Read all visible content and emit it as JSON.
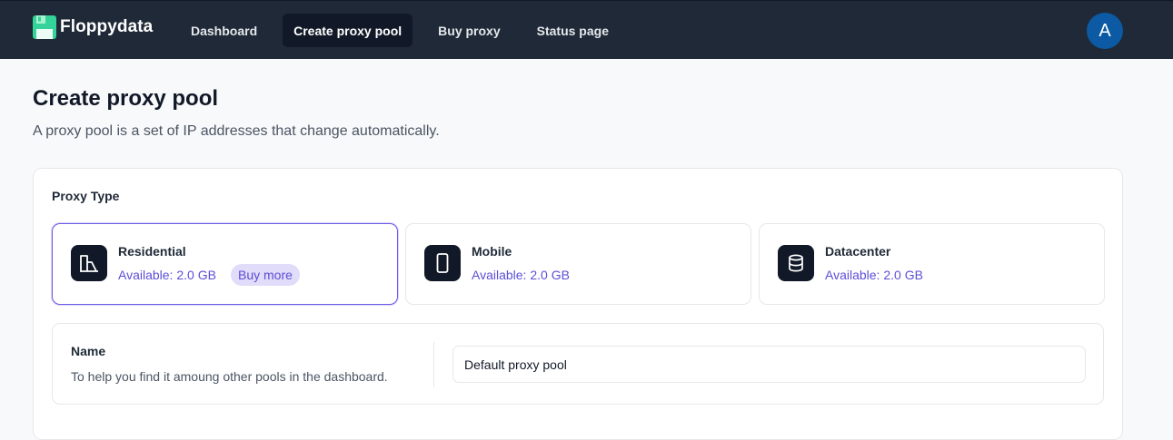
{
  "header": {
    "brand": "Floppydata",
    "nav": [
      {
        "label": "Dashboard",
        "active": false
      },
      {
        "label": "Create proxy pool",
        "active": true
      },
      {
        "label": "Buy proxy",
        "active": false
      },
      {
        "label": "Status page",
        "active": false
      }
    ],
    "avatar_initial": "A"
  },
  "page": {
    "title": "Create proxy pool",
    "subtitle": "A proxy pool is a set of IP addresses that change automatically."
  },
  "form": {
    "proxy_type_label": "Proxy Type",
    "proxy_types": [
      {
        "name": "Residential",
        "available": "Available: 2.0 GB",
        "icon": "residential-building-icon",
        "selected": true,
        "action": "Buy more"
      },
      {
        "name": "Mobile",
        "available": "Available: 2.0 GB",
        "icon": "mobile-phone-icon",
        "selected": false
      },
      {
        "name": "Datacenter",
        "available": "Available: 2.0 GB",
        "icon": "database-icon",
        "selected": false
      }
    ],
    "name_label": "Name",
    "name_help": "To help you find it amoung other pools in the dashboard.",
    "name_value": "Default proxy pool"
  },
  "colors": {
    "header_bg": "#1f2937",
    "accent": "#5b4fd6",
    "logo": "#34d399",
    "avatar_bg": "#0b5aa3"
  }
}
